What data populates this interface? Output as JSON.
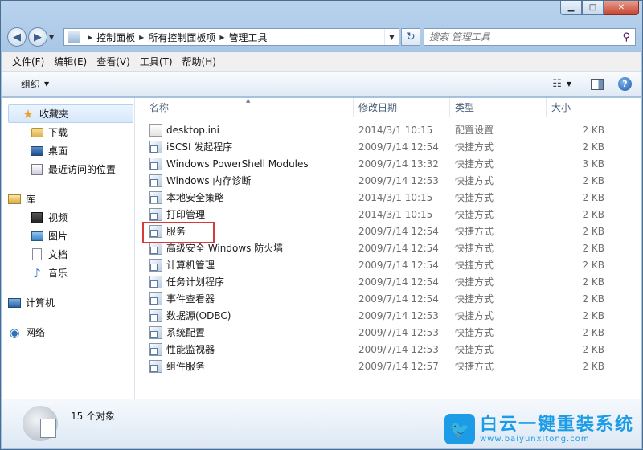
{
  "address": {
    "crumbs": [
      "控制面板",
      "所有控制面板项",
      "管理工具"
    ]
  },
  "search": {
    "placeholder": "搜索 管理工具"
  },
  "menu": [
    "文件(F)",
    "编辑(E)",
    "查看(V)",
    "工具(T)",
    "帮助(H)"
  ],
  "toolbar": {
    "organize_label": "组织"
  },
  "nav": {
    "favorites": {
      "label": "收藏夹",
      "items": [
        "下载",
        "桌面",
        "最近访问的位置"
      ]
    },
    "libraries": {
      "label": "库",
      "items": [
        "视频",
        "图片",
        "文档",
        "音乐"
      ]
    },
    "computer": "计算机",
    "network": "网络"
  },
  "columns": {
    "name": "名称",
    "date": "修改日期",
    "type": "类型",
    "size": "大小"
  },
  "files": [
    {
      "name": "desktop.ini",
      "date": "2014/3/1 10:15",
      "type": "配置设置",
      "size": "2 KB"
    },
    {
      "name": "iSCSI 发起程序",
      "date": "2009/7/14 12:54",
      "type": "快捷方式",
      "size": "2 KB"
    },
    {
      "name": "Windows PowerShell Modules",
      "date": "2009/7/14 13:32",
      "type": "快捷方式",
      "size": "3 KB"
    },
    {
      "name": "Windows 内存诊断",
      "date": "2009/7/14 12:53",
      "type": "快捷方式",
      "size": "2 KB"
    },
    {
      "name": "本地安全策略",
      "date": "2014/3/1 10:15",
      "type": "快捷方式",
      "size": "2 KB"
    },
    {
      "name": "打印管理",
      "date": "2014/3/1 10:15",
      "type": "快捷方式",
      "size": "2 KB"
    },
    {
      "name": "服务",
      "date": "2009/7/14 12:54",
      "type": "快捷方式",
      "size": "2 KB"
    },
    {
      "name": "高级安全 Windows 防火墙",
      "date": "2009/7/14 12:54",
      "type": "快捷方式",
      "size": "2 KB"
    },
    {
      "name": "计算机管理",
      "date": "2009/7/14 12:54",
      "type": "快捷方式",
      "size": "2 KB"
    },
    {
      "name": "任务计划程序",
      "date": "2009/7/14 12:54",
      "type": "快捷方式",
      "size": "2 KB"
    },
    {
      "name": "事件查看器",
      "date": "2009/7/14 12:54",
      "type": "快捷方式",
      "size": "2 KB"
    },
    {
      "name": "数据源(ODBC)",
      "date": "2009/7/14 12:53",
      "type": "快捷方式",
      "size": "2 KB"
    },
    {
      "name": "系统配置",
      "date": "2009/7/14 12:53",
      "type": "快捷方式",
      "size": "2 KB"
    },
    {
      "name": "性能监视器",
      "date": "2009/7/14 12:53",
      "type": "快捷方式",
      "size": "2 KB"
    },
    {
      "name": "组件服务",
      "date": "2009/7/14 12:57",
      "type": "快捷方式",
      "size": "2 KB"
    }
  ],
  "status": {
    "count_text": "15 个对象"
  },
  "watermark": {
    "title": "白云一键重装系统",
    "url": "www.baiyunxitong.com"
  },
  "colors": {
    "highlight": "#d63a3a",
    "watermark": "#1c9be6"
  }
}
